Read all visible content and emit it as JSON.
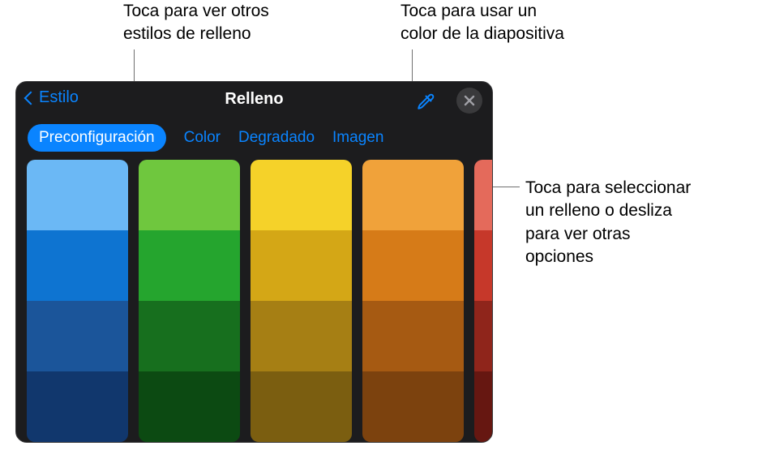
{
  "annotations": {
    "top_left": "Toca para ver otros\nestilos de relleno",
    "top_right": "Toca para usar un\ncolor de la diapositiva",
    "side": "Toca para seleccionar\nun relleno o desliza\npara ver otras\nopciones"
  },
  "panel": {
    "back_label": "Estilo",
    "title": "Relleno",
    "tabs": {
      "preset": "Preconfiguración",
      "color": "Color",
      "gradient": "Degradado",
      "image": "Imagen"
    },
    "icons": {
      "back": "chevron-left-icon",
      "eyedropper": "eyedropper-icon",
      "close": "close-icon"
    }
  },
  "swatches": {
    "columns": [
      [
        "#6bb8f5",
        "#0e74d1",
        "#1b559a",
        "#11376d"
      ],
      [
        "#6fc73e",
        "#25a52e",
        "#176f1e",
        "#0c4a12"
      ],
      [
        "#f5d229",
        "#d4a716",
        "#a67f14",
        "#7b5e10"
      ],
      [
        "#f0a23a",
        "#d67b18",
        "#a65a12",
        "#7c420e"
      ],
      [
        "#e46a5b",
        "#c6382a",
        "#8f251b",
        "#661711"
      ]
    ]
  }
}
